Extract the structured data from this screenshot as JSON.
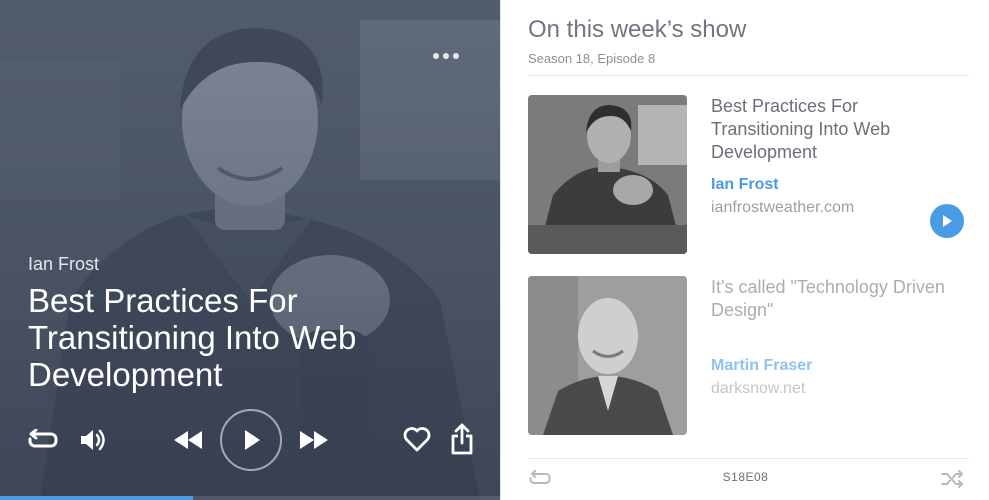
{
  "now_playing": {
    "author": "Ian Frost",
    "title": "Best Practices For Transitioning Into Web Development",
    "progress_fraction": 0.385
  },
  "controls": {
    "icons": [
      "more-icon",
      "repeat-icon",
      "volume-icon",
      "rewind-icon",
      "play-icon",
      "fast-forward-icon",
      "heart-icon",
      "share-icon"
    ]
  },
  "episode": {
    "heading": "On this week’s show",
    "subheading": "Season 18, Episode 8",
    "code": "S18E08",
    "guests": [
      {
        "topic": "Best Practices For Transitioning Into Web Development",
        "name": "Ian Frost",
        "site": "ianfrostweather.com"
      },
      {
        "topic": "It's called \"Technology Driven Design\"",
        "name": "Martin Fraser",
        "site": "darksnow.net"
      }
    ]
  },
  "colors": {
    "accent": "#4a9be6",
    "panel_tint": "#4f5b6b",
    "text_muted": "#6f7681"
  }
}
